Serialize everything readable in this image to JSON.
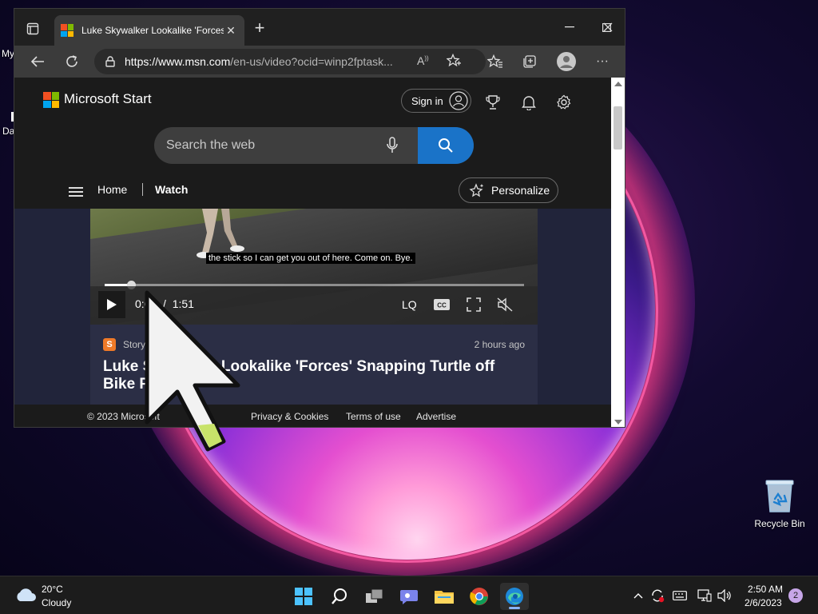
{
  "desktop": {
    "recycle_bin_label": "Recycle Bin",
    "left_edge_texts": [
      "My",
      "Da"
    ]
  },
  "browser": {
    "tab_title": "Luke Skywalker Lookalike 'Forces",
    "url_host": "https://www.msn.com",
    "url_path": "/en-us/video?ocid=winp2fptask...",
    "accent_color": "#1a73c8"
  },
  "msn": {
    "brand": "Microsoft Start",
    "signin_label": "Sign in",
    "search_placeholder": "Search the web",
    "nav": {
      "home": "Home",
      "watch": "Watch"
    },
    "personalize_label": "Personalize"
  },
  "video": {
    "caption": "the stick so I can get you out of here. Come on. Bye.",
    "current_time": "0:07",
    "duration": "1:51",
    "progress_fraction": 0.063,
    "quality": "LQ",
    "cc_label": "CC"
  },
  "article": {
    "source": "Storyful",
    "source_initial": "S",
    "time_ago": "2 hours ago",
    "headline": "Luke Skywalker Lookalike 'Forces' Snapping Turtle off Bike Path"
  },
  "footer": {
    "copyright": "© 2023 Microsoft",
    "privacy": "Privacy & Cookies",
    "terms": "Terms of use",
    "advertise": "Advertise"
  },
  "taskbar": {
    "weather_temp": "20°C",
    "weather_desc": "Cloudy",
    "time": "2:50 AM",
    "date": "2/6/2023",
    "notification_count": "2"
  }
}
